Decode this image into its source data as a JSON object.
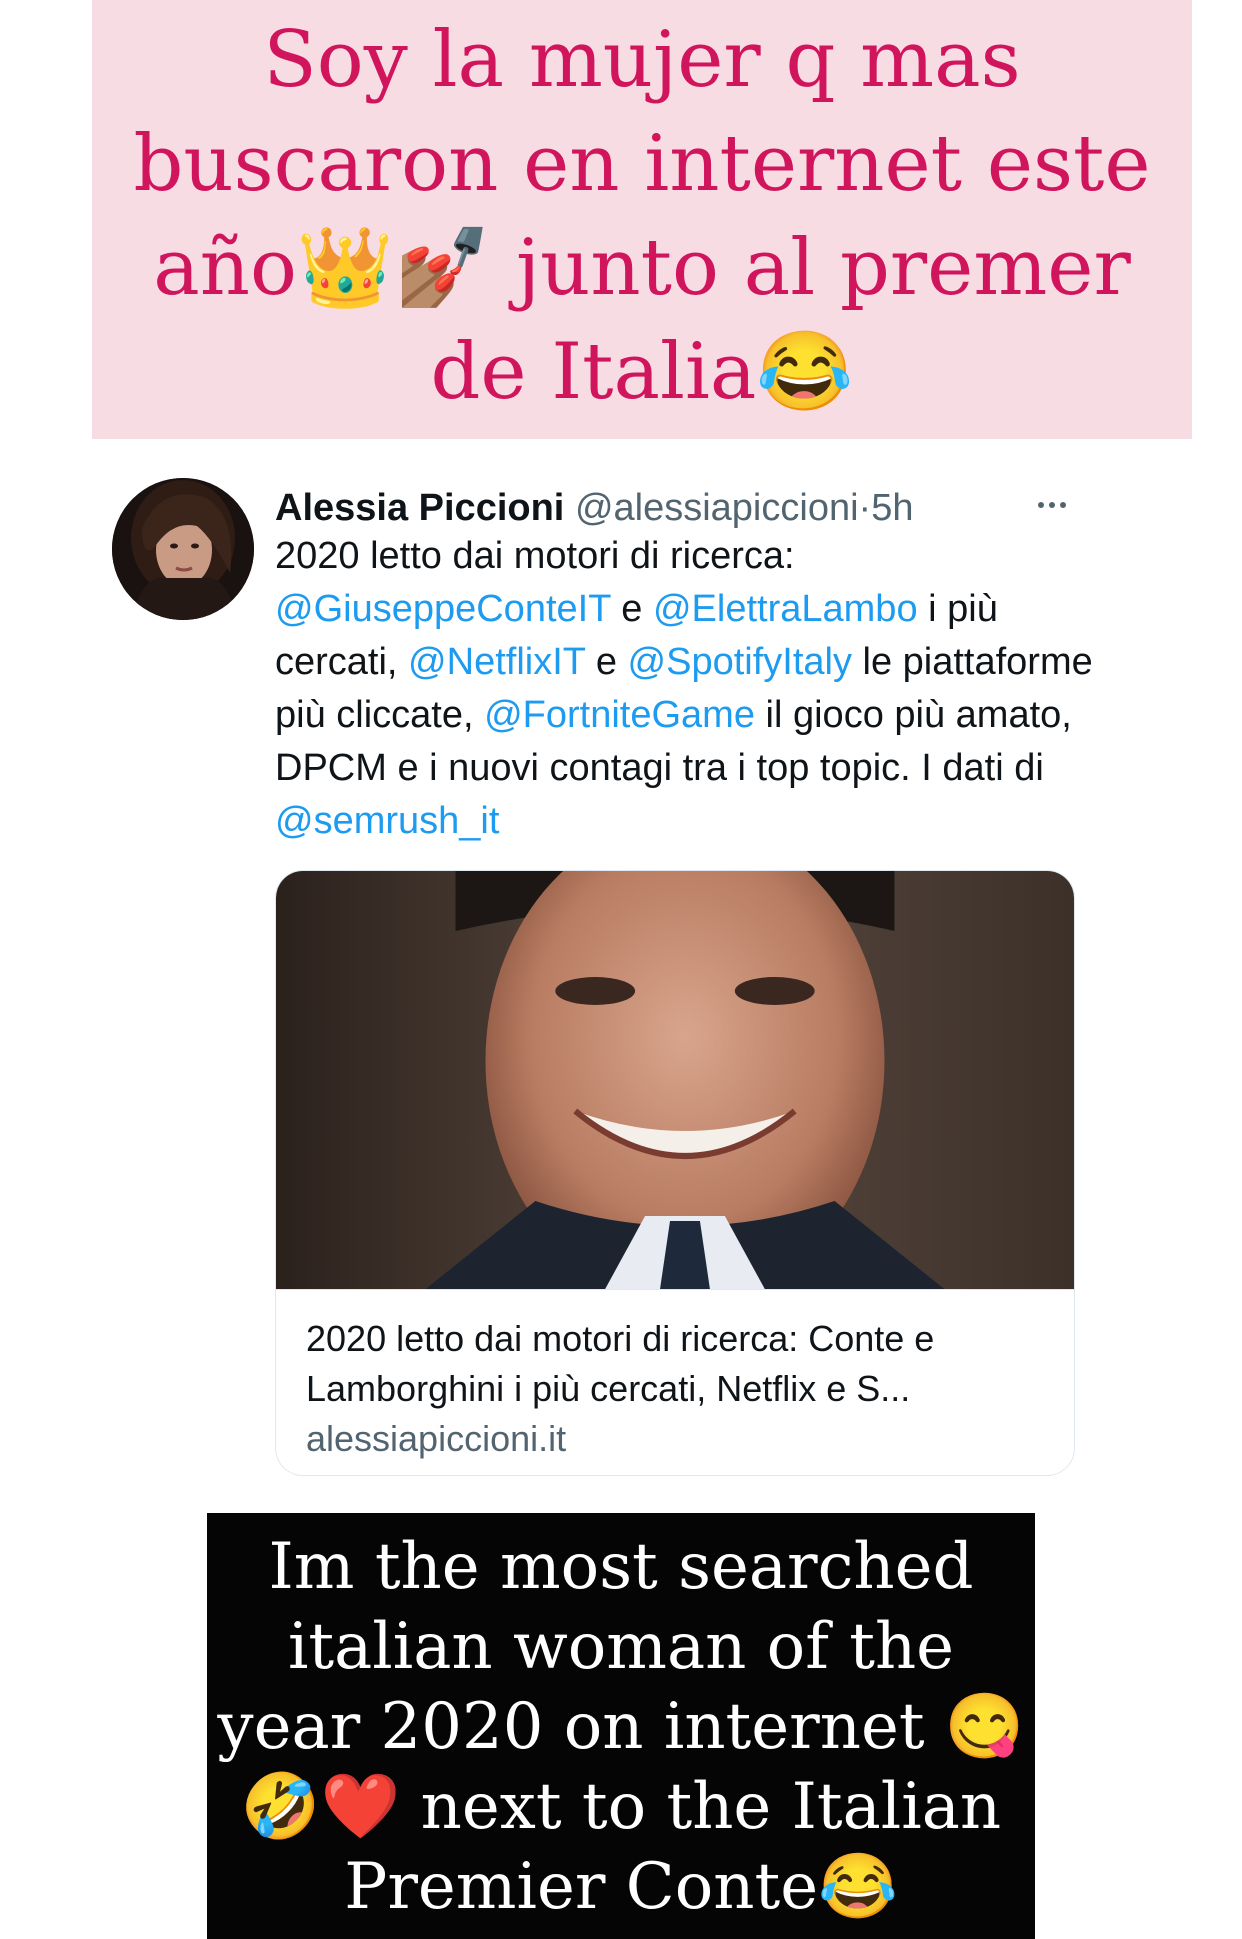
{
  "story": {
    "caption_top": "Soy la mujer q mas buscaron en internet este año👑💅🏽 junto al premer de Italia😂",
    "caption_top_color": "#d0155d",
    "caption_top_background": "#f8dce4",
    "caption_bottom": "Im the most searched italian woman of the year 2020 on internet 😋🤣❤️ next to the Italian Premier Conte😂",
    "caption_bottom_background": "#050505"
  },
  "tweet": {
    "author_name": "Alessia Piccioni",
    "author_handle": "@alessiapiccioni",
    "separator": "·",
    "time": "5h",
    "more_icon": "more-horizontal-icon",
    "text": {
      "t1": "2020 letto dai motori di ricerca: ",
      "m1": "@GiuseppeConteIT",
      "t2": " e ",
      "m2": "@ElettraLambo",
      "t3": " i più cercati, ",
      "m3": "@NetflixIT",
      "t4": " e ",
      "m4": "@SpotifyItaly",
      "t5": " le piattaforme più cliccate, ",
      "m5": "@FortniteGame",
      "t6": " il gioco più amato, DPCM e i nuovi contagi tra i top topic. I dati di ",
      "m6": "@semrush_it"
    },
    "link_color": "#1d9bf0",
    "card": {
      "title": "2020 letto dai motori di ricerca: Conte e Lamborghini i più cercati, Netflix e S...",
      "domain": "alessiapiccioni.it"
    }
  }
}
